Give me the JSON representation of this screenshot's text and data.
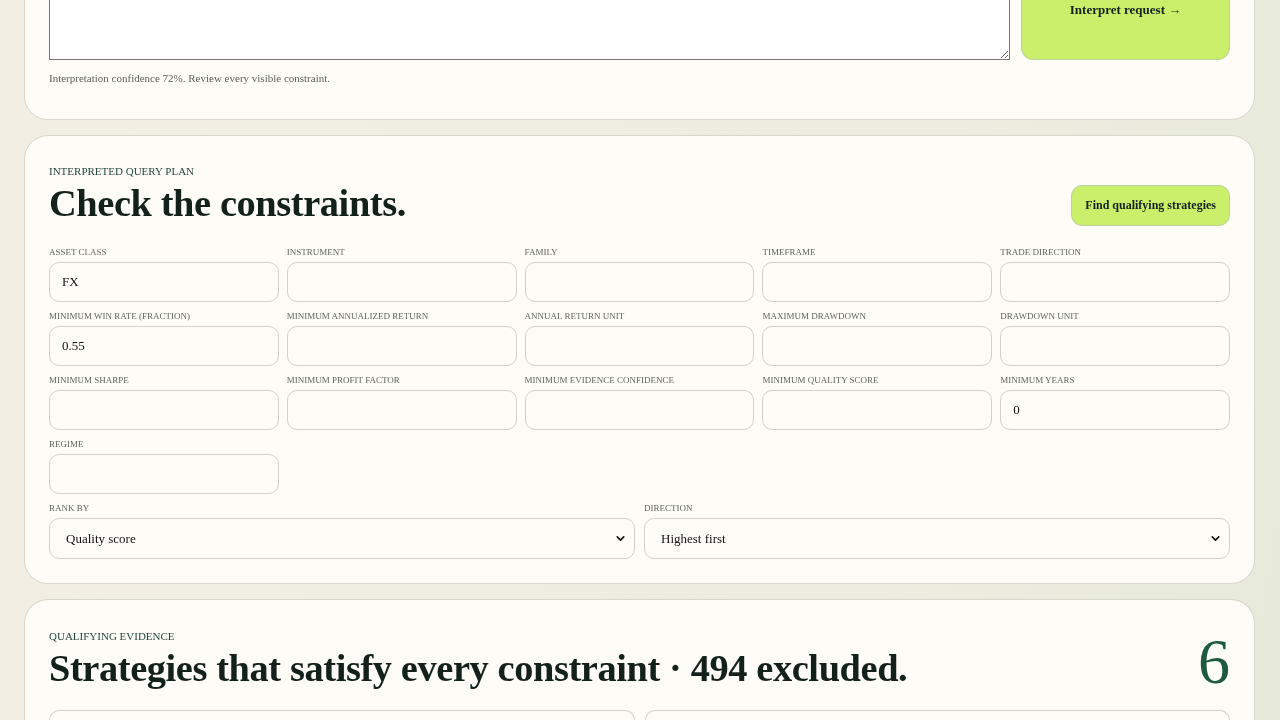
{
  "request_panel": {
    "submit_button": "Interpret request →",
    "confidence_note": "Interpretation confidence 72%. Review every visible constraint."
  },
  "query_plan": {
    "eyebrow": "INTERPRETED QUERY PLAN",
    "title": "Check the constraints.",
    "action_button": "Find qualifying strategies",
    "fields": [
      {
        "label": "ASSET CLASS",
        "value": "FX"
      },
      {
        "label": "INSTRUMENT"
      },
      {
        "label": "FAMILY"
      },
      {
        "label": "TIMEFRAME"
      },
      {
        "label": "TRADE DIRECTION"
      },
      {
        "label": "MINIMUM WIN RATE (FRACTION)",
        "value": "0.55"
      },
      {
        "label": "MINIMUM ANNUALIZED RETURN"
      },
      {
        "label": "ANNUAL RETURN UNIT"
      },
      {
        "label": "MAXIMUM DRAWDOWN"
      },
      {
        "label": "DRAWDOWN UNIT"
      },
      {
        "label": "MINIMUM SHARPE"
      },
      {
        "label": "MINIMUM PROFIT FACTOR"
      },
      {
        "label": "MINIMUM EVIDENCE CONFIDENCE"
      },
      {
        "label": "MINIMUM QUALITY SCORE"
      },
      {
        "label": "MINIMUM YEARS",
        "value": "0"
      },
      {
        "label": "REGIME"
      }
    ],
    "ranking": [
      {
        "label": "RANK BY",
        "value": "Quality score"
      },
      {
        "label": "DIRECTION",
        "value": "Highest first"
      }
    ]
  },
  "results": {
    "eyebrow": "QUALIFYING EVIDENCE",
    "title": "Strategies that satisfy every constraint · 494 excluded.",
    "count": "6",
    "cards": [
      {
        "kind": "strategy"
      },
      {
        "kind": "strategy"
      }
    ]
  }
}
